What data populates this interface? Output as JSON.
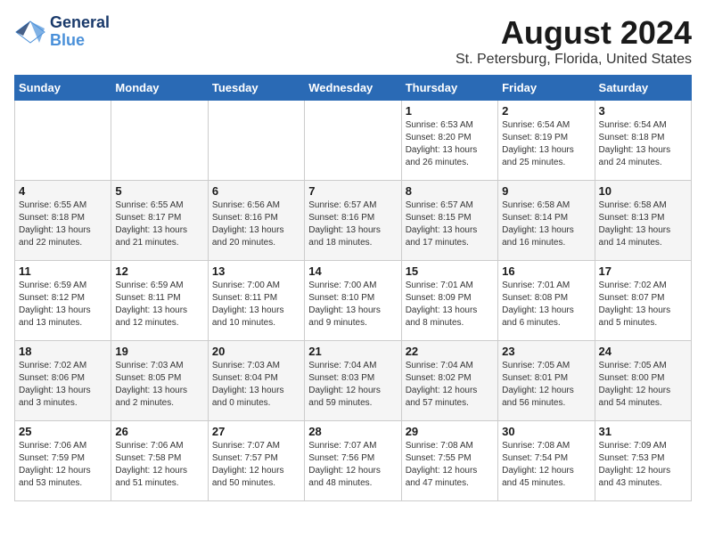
{
  "logo": {
    "general": "General",
    "blue": "Blue"
  },
  "title": "August 2024",
  "subtitle": "St. Petersburg, Florida, United States",
  "weekdays": [
    "Sunday",
    "Monday",
    "Tuesday",
    "Wednesday",
    "Thursday",
    "Friday",
    "Saturday"
  ],
  "weeks": [
    [
      {
        "day": "",
        "info": ""
      },
      {
        "day": "",
        "info": ""
      },
      {
        "day": "",
        "info": ""
      },
      {
        "day": "",
        "info": ""
      },
      {
        "day": "1",
        "info": "Sunrise: 6:53 AM\nSunset: 8:20 PM\nDaylight: 13 hours\nand 26 minutes."
      },
      {
        "day": "2",
        "info": "Sunrise: 6:54 AM\nSunset: 8:19 PM\nDaylight: 13 hours\nand 25 minutes."
      },
      {
        "day": "3",
        "info": "Sunrise: 6:54 AM\nSunset: 8:18 PM\nDaylight: 13 hours\nand 24 minutes."
      }
    ],
    [
      {
        "day": "4",
        "info": "Sunrise: 6:55 AM\nSunset: 8:18 PM\nDaylight: 13 hours\nand 22 minutes."
      },
      {
        "day": "5",
        "info": "Sunrise: 6:55 AM\nSunset: 8:17 PM\nDaylight: 13 hours\nand 21 minutes."
      },
      {
        "day": "6",
        "info": "Sunrise: 6:56 AM\nSunset: 8:16 PM\nDaylight: 13 hours\nand 20 minutes."
      },
      {
        "day": "7",
        "info": "Sunrise: 6:57 AM\nSunset: 8:16 PM\nDaylight: 13 hours\nand 18 minutes."
      },
      {
        "day": "8",
        "info": "Sunrise: 6:57 AM\nSunset: 8:15 PM\nDaylight: 13 hours\nand 17 minutes."
      },
      {
        "day": "9",
        "info": "Sunrise: 6:58 AM\nSunset: 8:14 PM\nDaylight: 13 hours\nand 16 minutes."
      },
      {
        "day": "10",
        "info": "Sunrise: 6:58 AM\nSunset: 8:13 PM\nDaylight: 13 hours\nand 14 minutes."
      }
    ],
    [
      {
        "day": "11",
        "info": "Sunrise: 6:59 AM\nSunset: 8:12 PM\nDaylight: 13 hours\nand 13 minutes."
      },
      {
        "day": "12",
        "info": "Sunrise: 6:59 AM\nSunset: 8:11 PM\nDaylight: 13 hours\nand 12 minutes."
      },
      {
        "day": "13",
        "info": "Sunrise: 7:00 AM\nSunset: 8:11 PM\nDaylight: 13 hours\nand 10 minutes."
      },
      {
        "day": "14",
        "info": "Sunrise: 7:00 AM\nSunset: 8:10 PM\nDaylight: 13 hours\nand 9 minutes."
      },
      {
        "day": "15",
        "info": "Sunrise: 7:01 AM\nSunset: 8:09 PM\nDaylight: 13 hours\nand 8 minutes."
      },
      {
        "day": "16",
        "info": "Sunrise: 7:01 AM\nSunset: 8:08 PM\nDaylight: 13 hours\nand 6 minutes."
      },
      {
        "day": "17",
        "info": "Sunrise: 7:02 AM\nSunset: 8:07 PM\nDaylight: 13 hours\nand 5 minutes."
      }
    ],
    [
      {
        "day": "18",
        "info": "Sunrise: 7:02 AM\nSunset: 8:06 PM\nDaylight: 13 hours\nand 3 minutes."
      },
      {
        "day": "19",
        "info": "Sunrise: 7:03 AM\nSunset: 8:05 PM\nDaylight: 13 hours\nand 2 minutes."
      },
      {
        "day": "20",
        "info": "Sunrise: 7:03 AM\nSunset: 8:04 PM\nDaylight: 13 hours\nand 0 minutes."
      },
      {
        "day": "21",
        "info": "Sunrise: 7:04 AM\nSunset: 8:03 PM\nDaylight: 12 hours\nand 59 minutes."
      },
      {
        "day": "22",
        "info": "Sunrise: 7:04 AM\nSunset: 8:02 PM\nDaylight: 12 hours\nand 57 minutes."
      },
      {
        "day": "23",
        "info": "Sunrise: 7:05 AM\nSunset: 8:01 PM\nDaylight: 12 hours\nand 56 minutes."
      },
      {
        "day": "24",
        "info": "Sunrise: 7:05 AM\nSunset: 8:00 PM\nDaylight: 12 hours\nand 54 minutes."
      }
    ],
    [
      {
        "day": "25",
        "info": "Sunrise: 7:06 AM\nSunset: 7:59 PM\nDaylight: 12 hours\nand 53 minutes."
      },
      {
        "day": "26",
        "info": "Sunrise: 7:06 AM\nSunset: 7:58 PM\nDaylight: 12 hours\nand 51 minutes."
      },
      {
        "day": "27",
        "info": "Sunrise: 7:07 AM\nSunset: 7:57 PM\nDaylight: 12 hours\nand 50 minutes."
      },
      {
        "day": "28",
        "info": "Sunrise: 7:07 AM\nSunset: 7:56 PM\nDaylight: 12 hours\nand 48 minutes."
      },
      {
        "day": "29",
        "info": "Sunrise: 7:08 AM\nSunset: 7:55 PM\nDaylight: 12 hours\nand 47 minutes."
      },
      {
        "day": "30",
        "info": "Sunrise: 7:08 AM\nSunset: 7:54 PM\nDaylight: 12 hours\nand 45 minutes."
      },
      {
        "day": "31",
        "info": "Sunrise: 7:09 AM\nSunset: 7:53 PM\nDaylight: 12 hours\nand 43 minutes."
      }
    ]
  ]
}
